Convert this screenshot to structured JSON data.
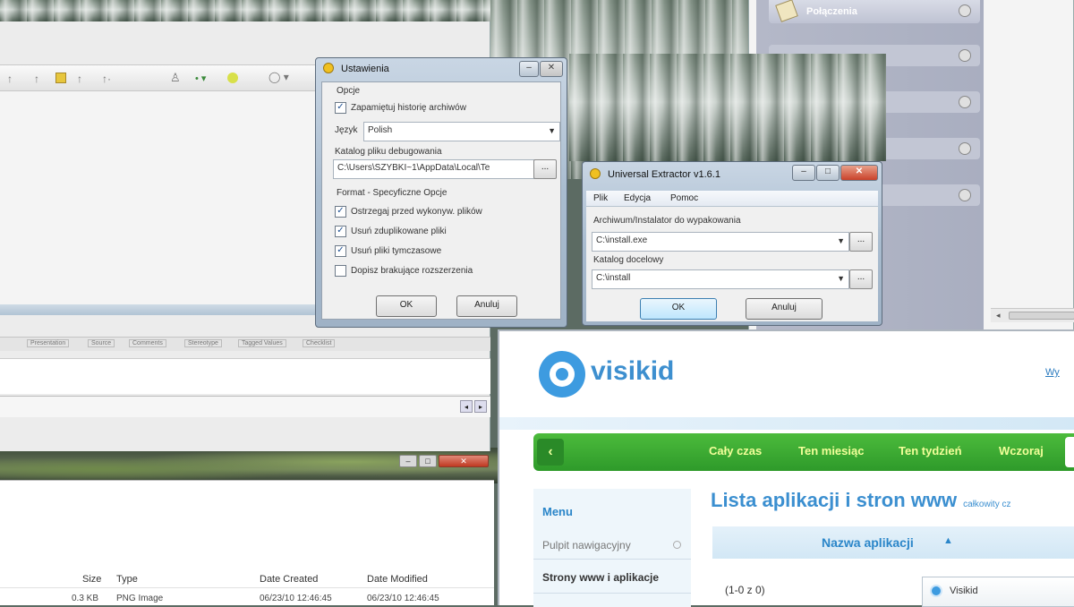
{
  "settings_dialog": {
    "title": "Ustawienia",
    "section_options": "Opcje",
    "remember_history": "Zapamiętuj historię archiwów",
    "language_label": "Język",
    "language_value": "Polish",
    "debug_dir_label": "Katalog pliku debugowania",
    "debug_dir_value": "C:\\Users\\SZYBKI~1\\AppData\\Local\\Te",
    "browse": "...",
    "section_format": "Format - Specyficzne Opcje",
    "opt1": "Ostrzegaj przed wykonyw. plików",
    "opt2": "Usuń zduplikowane pliki",
    "opt3": "Usuń pliki tymczasowe",
    "opt4": "Dopisz brakujące rozszerzenia",
    "ok": "OK",
    "cancel": "Anuluj"
  },
  "extractor_dialog": {
    "title": "Universal Extractor v1.6.1",
    "menu": [
      "Plik",
      "Edycja",
      "Pomoc"
    ],
    "archive_label": "Archiwum/Instalator do wypakowania",
    "archive_value": "C:\\install.exe",
    "dest_label": "Katalog docelowy",
    "dest_value": "C:\\install",
    "browse": "...",
    "ok": "OK",
    "cancel": "Anuluj"
  },
  "right_panel": {
    "item_top": "Połączenia"
  },
  "bg_tabs": [
    "Presentation",
    "Source",
    "Comments",
    "Stereotype",
    "Tagged Values",
    "Checklist"
  ],
  "file_list": {
    "columns": [
      "Size",
      "Type",
      "Date Created",
      "Date Modified"
    ],
    "row": [
      "0.3 KB",
      "PNG Image",
      "06/23/10 12:46:45",
      "06/23/10 12:46:45"
    ]
  },
  "visikid": {
    "logo": "visikid",
    "top_link": "Wy",
    "nav": [
      "Cały czas",
      "Ten miesiąc",
      "Ten tydzień",
      "Wczoraj"
    ],
    "sidebar_heading": "Menu",
    "sidebar_items": [
      "Pulpit nawigacyjny",
      "Strony www i aplikacje"
    ],
    "page_title": "Lista aplikacji i stron www",
    "page_title_suffix": "całkowity cz",
    "column_header": "Nazwa aplikacji",
    "count": "(1-0 z 0)",
    "app_item": "Visikid"
  },
  "colors": {
    "visikid_green": "#3aa63a",
    "visikid_blue": "#2b8fcf",
    "nav_text": "#f7ffe0"
  }
}
